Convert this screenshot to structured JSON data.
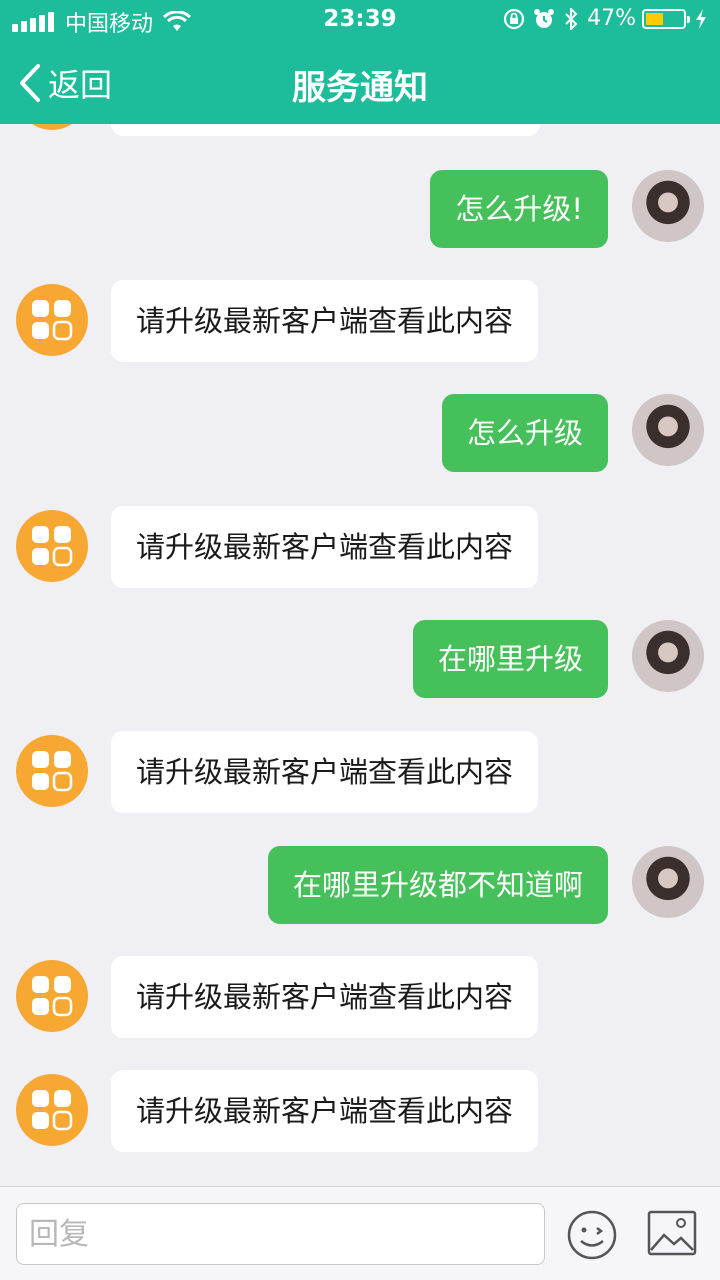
{
  "status_bar": {
    "carrier": "中国移动",
    "time": "23:39",
    "battery_percent": "47%",
    "battery_level": 0.47
  },
  "nav": {
    "back_label": "返回",
    "title": "服务通知"
  },
  "messages": [
    {
      "from": "me",
      "text": "怎么升级!"
    },
    {
      "from": "bot",
      "text": "请升级最新客户端查看此内容"
    },
    {
      "from": "me",
      "text": "怎么升级"
    },
    {
      "from": "bot",
      "text": "请升级最新客户端查看此内容"
    },
    {
      "from": "me",
      "text": "在哪里升级"
    },
    {
      "from": "bot",
      "text": "请升级最新客户端查看此内容"
    },
    {
      "from": "me",
      "text": "在哪里升级都不知道啊"
    },
    {
      "from": "bot",
      "text": "请升级最新客户端查看此内容"
    },
    {
      "from": "bot",
      "text": "请升级最新客户端查看此内容"
    }
  ],
  "input": {
    "placeholder": "回复",
    "emoji_icon": "smiley-face-icon",
    "image_icon": "picture-icon"
  },
  "colors": {
    "header": "#1dbd9b",
    "my_bubble": "#45c05a",
    "bot_avatar": "#f7a833",
    "background": "#efeff4"
  }
}
